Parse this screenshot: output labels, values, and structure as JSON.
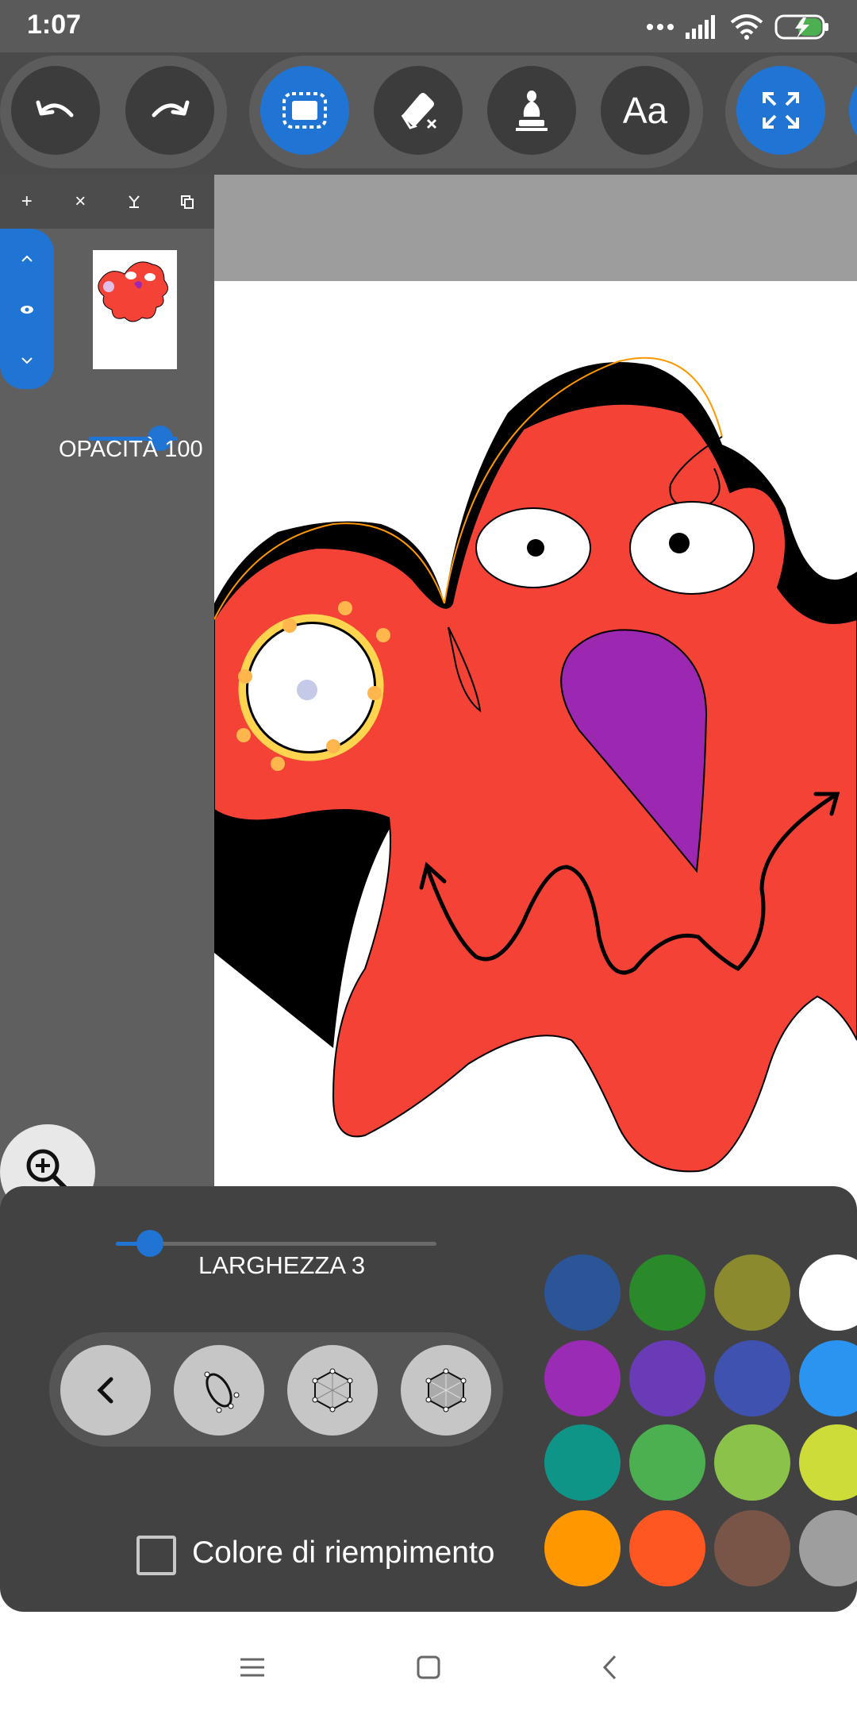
{
  "status_bar": {
    "time": "1:07",
    "icons": [
      "signal-dots-icon",
      "cell-signal-icon",
      "wifi-icon",
      "battery-charging-icon"
    ]
  },
  "toolbar": {
    "buttons": [
      {
        "name": "undo",
        "icon": "undo-icon"
      },
      {
        "name": "redo",
        "icon": "redo-icon"
      },
      {
        "name": "select",
        "icon": "select-rect-icon",
        "active": true
      },
      {
        "name": "eraser",
        "icon": "eraser-icon"
      },
      {
        "name": "fill",
        "icon": "bucket-icon"
      },
      {
        "name": "text",
        "label": "Aa"
      },
      {
        "name": "fullscreen",
        "icon": "fullscreen-icon",
        "active": true
      }
    ],
    "text_tool_label": "Aa",
    "accent": "#1f74d4"
  },
  "layers_panel": {
    "actions": [
      "+",
      "×",
      "merge-down-icon",
      "duplicate-icon"
    ],
    "opacity_label": "OPACITÀ 100",
    "opacity_value": 100
  },
  "brush_panel": {
    "width_label": "LARGHEZZA 3",
    "width_value": 3,
    "fill_checkbox": {
      "label": "Colore di riempimento",
      "checked": false
    },
    "shape_buttons": [
      "back-icon",
      "ellipse-icon",
      "hexagon-icon",
      "hexagon-filled-icon"
    ]
  },
  "palette": {
    "rows": [
      [
        "#2b5597",
        "#2a8a2a",
        "#8b8a2e",
        "#ffffff"
      ],
      [
        "#9a2bb5",
        "#6a3bb7",
        "#4052b0",
        "#2b93f0"
      ],
      [
        "#0f9488",
        "#4caf50",
        "#8bc34a",
        "#cddc39"
      ],
      [
        "#ff9800",
        "#ff5722",
        "#795548",
        "#9e9e9e"
      ]
    ]
  },
  "drawing": {
    "body_color": "#f44336",
    "tongue_color": "#9c27b0",
    "outline_color": "#000000",
    "selection_color": "#ffb300"
  }
}
